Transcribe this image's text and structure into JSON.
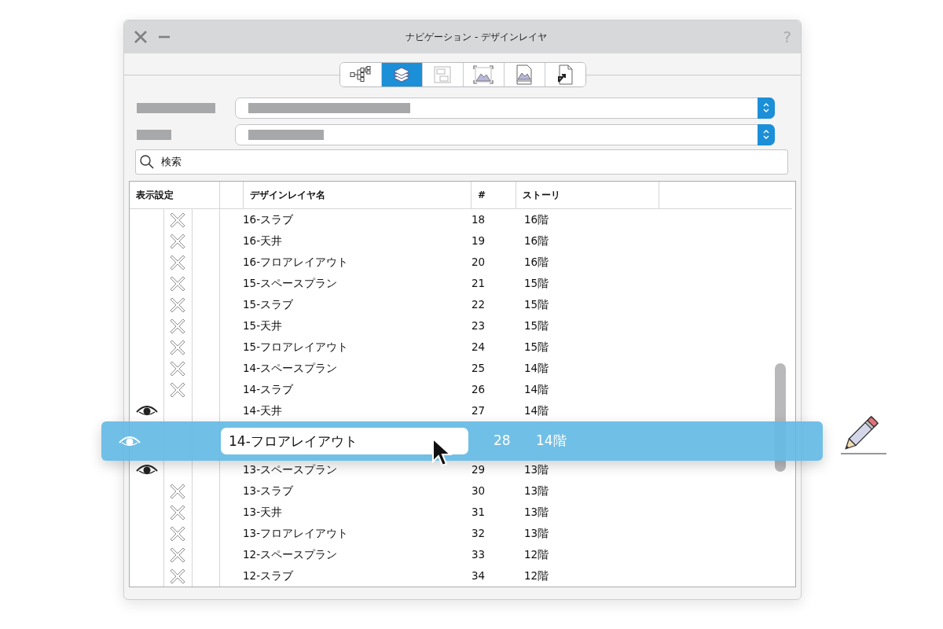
{
  "window": {
    "title": "ナビゲーション - デザインレイヤ",
    "help": "?"
  },
  "tabs": [
    {
      "kind": "tree",
      "selected": false
    },
    {
      "kind": "layers",
      "selected": true
    },
    {
      "kind": "plan",
      "selected": false
    },
    {
      "kind": "frame",
      "selected": false
    },
    {
      "kind": "sheet",
      "selected": false
    },
    {
      "kind": "shortcut",
      "selected": false
    }
  ],
  "selectors": [
    {
      "kind": "dropdown"
    },
    {
      "kind": "dropdown"
    }
  ],
  "search": {
    "placeholder": "検索"
  },
  "table": {
    "columns": [
      "表示設定",
      "デザインレイヤ名",
      "#",
      "ストーリ"
    ],
    "rows": [
      {
        "visible": false,
        "name": "16-スラブ",
        "number": "18",
        "story": "16階"
      },
      {
        "visible": false,
        "name": "16-天井",
        "number": "19",
        "story": "16階"
      },
      {
        "visible": false,
        "name": "16-フロアレイアウト",
        "number": "20",
        "story": "16階"
      },
      {
        "visible": false,
        "name": "15-スペースプラン",
        "number": "21",
        "story": "15階"
      },
      {
        "visible": false,
        "name": "15-スラブ",
        "number": "22",
        "story": "15階"
      },
      {
        "visible": false,
        "name": "15-天井",
        "number": "23",
        "story": "15階"
      },
      {
        "visible": false,
        "name": "15-フロアレイアウト",
        "number": "24",
        "story": "15階"
      },
      {
        "visible": false,
        "name": "14-スペースプラン",
        "number": "25",
        "story": "14階"
      },
      {
        "visible": false,
        "name": "14-スラブ",
        "number": "26",
        "story": "14階"
      },
      {
        "visible": true,
        "name": "14-天井",
        "number": "27",
        "story": "14階"
      },
      {
        "kind": "dragged",
        "visible": true,
        "name": "14-フロアレイアウト",
        "number": "28",
        "story": "14階"
      },
      {
        "visible": true,
        "name": "13-スペースプラン",
        "number": "29",
        "story": "13階"
      },
      {
        "visible": false,
        "name": "13-スラブ",
        "number": "30",
        "story": "13階"
      },
      {
        "visible": false,
        "name": "13-天井",
        "number": "31",
        "story": "13階"
      },
      {
        "visible": false,
        "name": "13-フロアレイアウト",
        "number": "32",
        "story": "13階"
      },
      {
        "visible": false,
        "name": "12-スペースプラン",
        "number": "33",
        "story": "12階"
      },
      {
        "visible": false,
        "name": "12-スラブ",
        "number": "34",
        "story": "12階"
      }
    ]
  }
}
